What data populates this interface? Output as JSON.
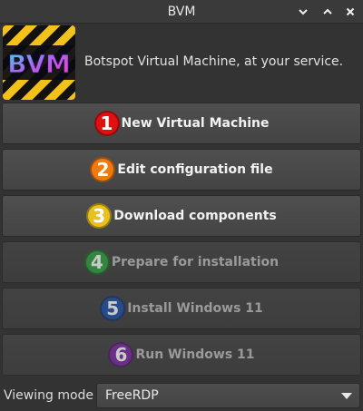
{
  "window": {
    "title": "BVM"
  },
  "titlebar_buttons": [
    {
      "icon": "minimize-icon"
    },
    {
      "icon": "maximize-icon"
    },
    {
      "icon": "close-icon"
    }
  ],
  "header": {
    "logo_text": "BVM",
    "tagline": "Botspot Virtual Machine, at your service."
  },
  "actions": [
    {
      "number": "1",
      "label": "New Virtual Machine",
      "color": "#e01010",
      "enabled": true
    },
    {
      "number": "2",
      "label": "Edit configuration file",
      "color": "#f07a10",
      "enabled": true
    },
    {
      "number": "3",
      "label": "Download components",
      "color": "#e8c020",
      "enabled": true
    },
    {
      "number": "4",
      "label": "Prepare for installation",
      "color": "#30a040",
      "enabled": false
    },
    {
      "number": "5",
      "label": "Install Windows 11",
      "color": "#2050a8",
      "enabled": false
    },
    {
      "number": "6",
      "label": "Run Windows 11",
      "color": "#7a2aa0",
      "enabled": false
    }
  ],
  "viewing_mode": {
    "label": "Viewing mode",
    "selected": "FreeRDP"
  },
  "colors": {
    "window_bg": "#333333",
    "button_bg": "#4a4a4a",
    "text": "#f2f2f2",
    "disabled_text": "#9a9a9a"
  }
}
